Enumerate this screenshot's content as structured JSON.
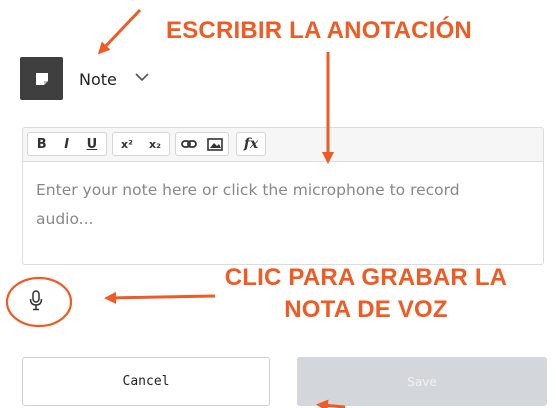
{
  "note_type": {
    "label": "Note",
    "icon": "sticky-note-icon"
  },
  "toolbar": {
    "bold": "B",
    "italic": "I",
    "underline": "U",
    "superscript": "x²",
    "subscript": "x₂",
    "link_icon": "link-icon",
    "image_icon": "image-icon",
    "formula": "fx"
  },
  "editor": {
    "placeholder": "Enter your note here or click the microphone to record audio..."
  },
  "mic": {
    "icon": "microphone-icon"
  },
  "buttons": {
    "cancel": "Cancel",
    "save": "Save"
  },
  "annotations": {
    "write": "ESCRIBIR LA ANOTACIÓN",
    "click_line1": "CLIC PARA GRABAR LA",
    "click_line2": "NOTA DE VOZ",
    "color": "#f05a23"
  },
  "colors": {
    "icon_box": "#3f3f3f",
    "save_disabled": "#d3d6da",
    "annotation": "#f05a23"
  }
}
